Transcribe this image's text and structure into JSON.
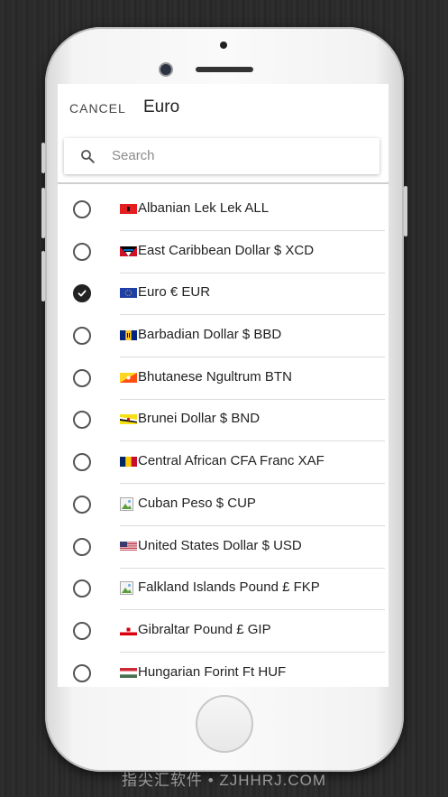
{
  "header": {
    "cancel_label": "CANCEL",
    "title": "Euro"
  },
  "search": {
    "placeholder": "Search"
  },
  "currencies": [
    {
      "label": "Albanian Lek Lek ALL",
      "flag": "albania-flag",
      "selected": false
    },
    {
      "label": "East Caribbean Dollar $ XCD",
      "flag": "antigua-flag",
      "selected": false
    },
    {
      "label": "Euro € EUR",
      "flag": "eu-flag",
      "selected": true
    },
    {
      "label": "Barbadian Dollar $ BBD",
      "flag": "barbados-flag",
      "selected": false
    },
    {
      "label": "Bhutanese Ngultrum BTN",
      "flag": "bhutan-flag",
      "selected": false
    },
    {
      "label": "Brunei Dollar $ BND",
      "flag": "brunei-flag",
      "selected": false
    },
    {
      "label": "Central African CFA Franc XAF",
      "flag": "chad-flag",
      "selected": false
    },
    {
      "label": " Cuban Peso $ CUP",
      "flag": "broken-image-icon",
      "selected": false
    },
    {
      "label": "United States Dollar $ USD",
      "flag": "us-flag",
      "selected": false
    },
    {
      "label": " Falkland Islands Pound £ FKP",
      "flag": "broken-image-icon",
      "selected": false
    },
    {
      "label": "Gibraltar Pound £ GIP",
      "flag": "gibraltar-flag",
      "selected": false
    },
    {
      "label": "Hungarian Forint Ft HUF",
      "flag": "hungary-flag",
      "selected": false
    }
  ],
  "watermark": "指尖汇软件 • ZJHHRJ.COM",
  "colors": {
    "accent": "#222222",
    "background": "#2b2b2b"
  }
}
